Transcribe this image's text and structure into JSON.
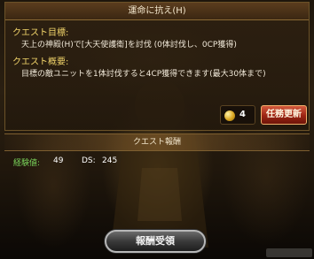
{
  "quest_panel": {
    "title": "運命に抗え(H)",
    "goal_label": "クエスト目標:",
    "goal_text": "天上の神殿(H)で[大天使護衛]を討伐 (0体討伐し、0CP獲得)",
    "summary_label": "クエスト概要:",
    "summary_text": "目標の敵ユニットを1体討伐すると4CP獲得できます(最大30体まで)",
    "coin_count": "4",
    "renew_button": "任務更新"
  },
  "reward_panel": {
    "title": "クエスト報酬",
    "exp_label": "経験値:",
    "exp_value": "49",
    "ds_label": "DS:",
    "ds_value": "245"
  },
  "receive_button": "報酬受領",
  "colors": {
    "label_yellow": "#f1d46a",
    "renew_red": "#9c2413",
    "exp_green": "#79d25a"
  },
  "icons": [
    "coin-icon"
  ]
}
